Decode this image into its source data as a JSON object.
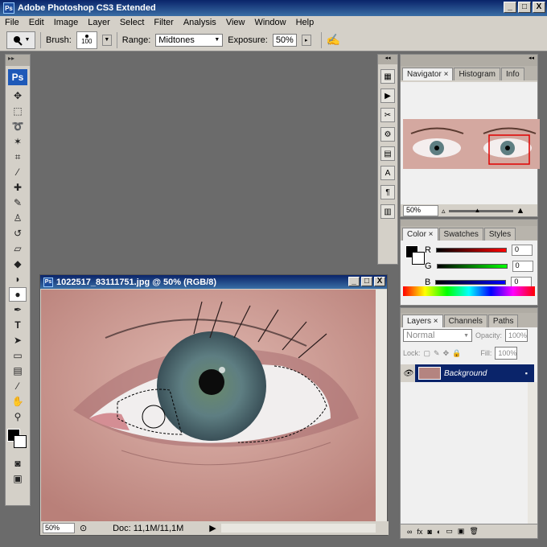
{
  "app": {
    "title": "Adobe Photoshop CS3 Extended",
    "logo": "Ps"
  },
  "menu": [
    "File",
    "Edit",
    "Image",
    "Layer",
    "Select",
    "Filter",
    "Analysis",
    "View",
    "Window",
    "Help"
  ],
  "options": {
    "brush_label": "Brush:",
    "brush_size": "100",
    "range_label": "Range:",
    "range_value": "Midtones",
    "exposure_label": "Exposure:",
    "exposure_value": "50%"
  },
  "document": {
    "title": "1022517_83111751.jpg @ 50% (RGB/8)",
    "zoom": "50%",
    "doc_size": "Doc: 11,1M/11,1M"
  },
  "navigator": {
    "tabs": [
      "Navigator",
      "Histogram",
      "Info"
    ],
    "zoom": "50%"
  },
  "color_panel": {
    "tabs": [
      "Color",
      "Swatches",
      "Styles"
    ],
    "channels": [
      {
        "label": "R",
        "value": "0",
        "color": "#c00000"
      },
      {
        "label": "G",
        "value": "0",
        "color": "#00a000"
      },
      {
        "label": "B",
        "value": "0",
        "color": "#0000c0"
      }
    ]
  },
  "layers_panel": {
    "tabs": [
      "Layers",
      "Channels",
      "Paths"
    ],
    "blend_mode": "Normal",
    "opacity_label": "Opacity:",
    "opacity": "100%",
    "lock_label": "Lock:",
    "fill_label": "Fill:",
    "fill": "100%",
    "layer_name": "Background"
  },
  "window_buttons": {
    "minimize": "_",
    "maximize": "□",
    "close": "X"
  },
  "colors": {
    "title_start": "#0a246a",
    "title_end": "#3a6ea5",
    "chrome": "#d4d0c8",
    "workspace": "#6b6b6b",
    "selected_layer": "#0a246a"
  }
}
